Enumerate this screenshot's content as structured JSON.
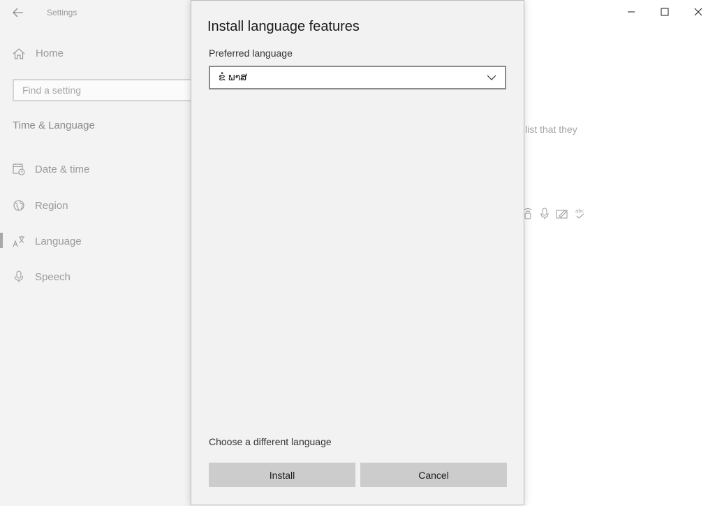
{
  "app": {
    "title": "Settings"
  },
  "sidebar": {
    "home_label": "Home",
    "search_placeholder": "Find a setting",
    "section_title": "Time & Language",
    "items": [
      {
        "label": "Date & time",
        "icon": "calendar-clock-icon"
      },
      {
        "label": "Region",
        "icon": "globe-icon"
      },
      {
        "label": "Language",
        "icon": "language-icon",
        "active": true
      },
      {
        "label": "Speech",
        "icon": "microphone-icon"
      }
    ]
  },
  "background": {
    "partial_text": "list that they",
    "feature_icons": [
      "text-to-speech-icon",
      "microphone-icon",
      "handwriting-icon",
      "spellcheck-icon"
    ]
  },
  "dialog": {
    "title": "Install language features",
    "preferred_language_label": "Preferred language",
    "selected_language": "ຂໍ ພາສ",
    "choose_different_link": "Choose a different language",
    "install_label": "Install",
    "cancel_label": "Cancel"
  },
  "colors": {
    "dialog_bg": "#f2f2f2",
    "button_bg": "#cccccc",
    "sidebar_bg": "#f3f3f3"
  }
}
